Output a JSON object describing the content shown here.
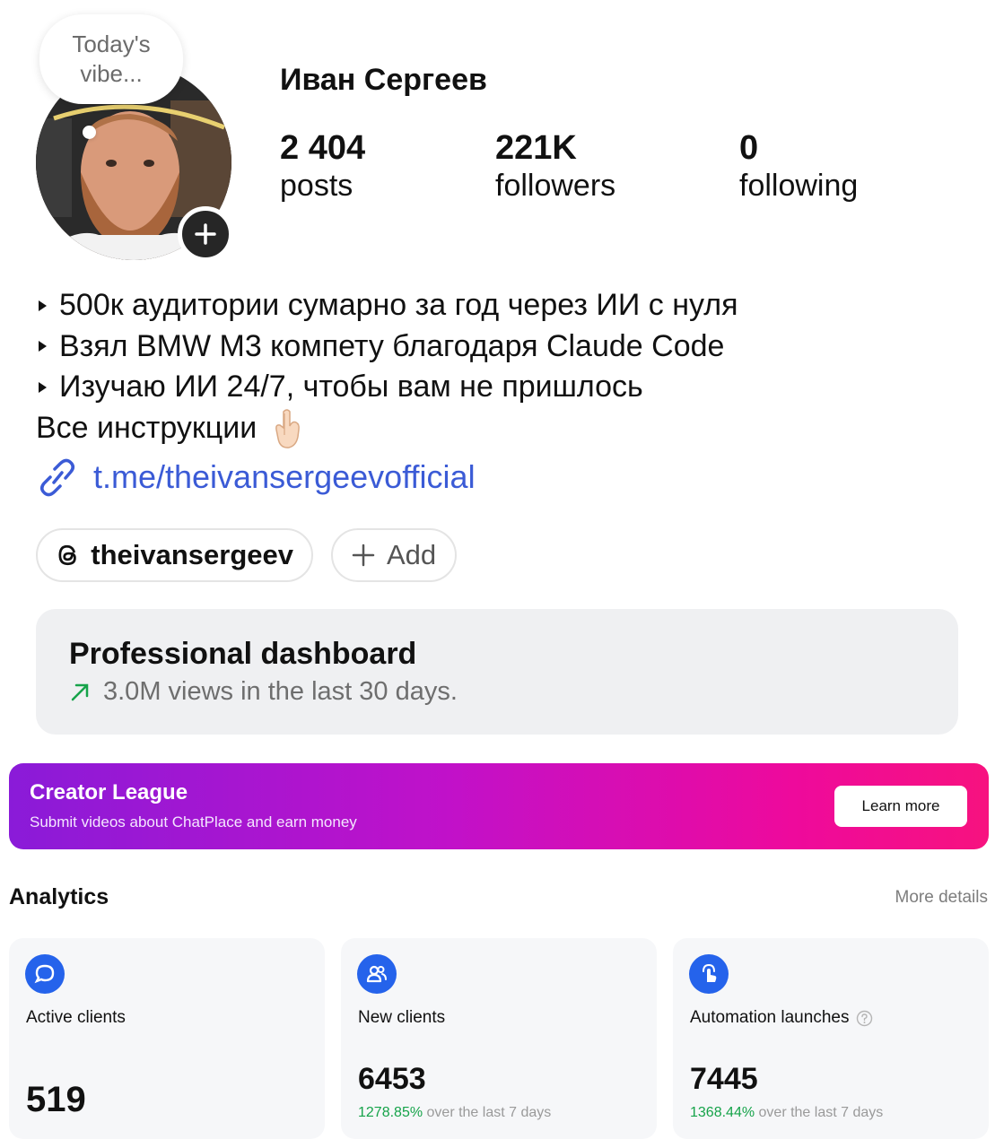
{
  "profile": {
    "vibe_note": "Today's vibe...",
    "name": "Иван Сергеев",
    "stats": [
      {
        "value": "2 404",
        "label": "posts"
      },
      {
        "value": "221K",
        "label": "followers"
      },
      {
        "value": "0",
        "label": "following"
      }
    ]
  },
  "bio": {
    "lines": [
      "500к аудитории сумарно за год через ИИ с нуля",
      "Взял BMW M3 компету благодаря Claude Code",
      "Изучаю ИИ 24/7, чтобы вам не пришлось"
    ],
    "cta": "Все инструкции",
    "link": "t.me/theivansergeevofficial"
  },
  "chips": {
    "threads_handle": "theivansergeev",
    "add_label": "Add"
  },
  "professional_dashboard": {
    "title": "Professional dashboard",
    "subtitle": "3.0M views in the last 30 days."
  },
  "creator_league": {
    "title": "Creator League",
    "subtitle": "Submit videos about ChatPlace and earn money",
    "button": "Learn more"
  },
  "analytics": {
    "title": "Analytics",
    "more_link": "More details",
    "cards": [
      {
        "label": "Active clients",
        "value": "519",
        "icon": "chat-bubble-icon"
      },
      {
        "label": "New clients",
        "value": "6453",
        "change_pct": "1278.85%",
        "change_text": "over the last 7 days",
        "icon": "users-icon"
      },
      {
        "label": "Automation launches",
        "value": "7445",
        "change_pct": "1368.44%",
        "change_text": "over the last 7 days",
        "icon": "tap-icon"
      }
    ]
  },
  "colors": {
    "link": "#3b5bd6",
    "accent_blue": "#2563eb",
    "positive": "#16a34a",
    "league_gradient_start": "#8a1bd8",
    "league_gradient_end": "#f7127f"
  }
}
